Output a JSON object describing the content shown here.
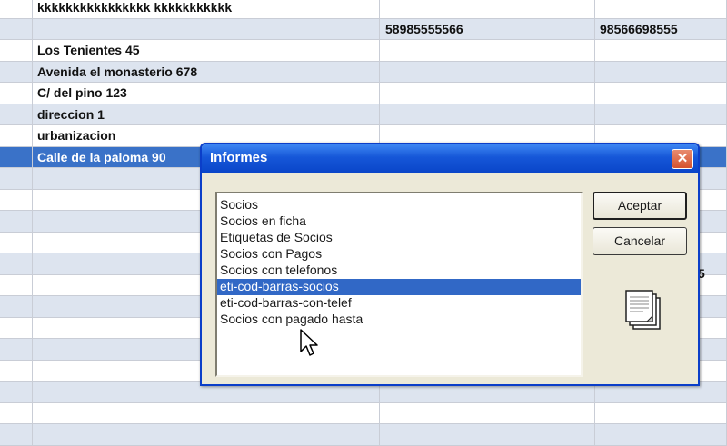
{
  "grid": {
    "rows": [
      {
        "c1": "kkkkkkkkkkkkkkkk kkkkkkkkkkk",
        "c2": "",
        "c3": "",
        "style": "normal"
      },
      {
        "c1": "",
        "c2": "58985555566",
        "c3": "98566698555",
        "style": "alt"
      },
      {
        "c1": "Los Tenientes 45",
        "c2": "",
        "c3": "",
        "style": "normal"
      },
      {
        "c1": "Avenida el monasterio 678",
        "c2": "",
        "c3": "",
        "style": "alt"
      },
      {
        "c1": "C/ del pino 123",
        "c2": "",
        "c3": "",
        "style": "normal"
      },
      {
        "c1": "direccion 1",
        "c2": "",
        "c3": "",
        "style": "alt"
      },
      {
        "c1": "urbanizacion",
        "c2": "",
        "c3": "",
        "style": "normal"
      },
      {
        "c1": "Calle de la paloma 90",
        "c2": "",
        "c3": "",
        "style": "sel"
      },
      {
        "c1": "",
        "c2": "",
        "c3": "",
        "style": "alt"
      },
      {
        "c1": "",
        "c2": "",
        "c3": "",
        "style": "normal"
      },
      {
        "c1": "",
        "c2": "",
        "c3": "",
        "style": "alt"
      },
      {
        "c1": "",
        "c2": "",
        "c3": "",
        "style": "normal"
      },
      {
        "c1": "",
        "c2": "",
        "c3": "",
        "style": "alt"
      },
      {
        "c1": "",
        "c2": "",
        "c3": "",
        "style": "normal"
      },
      {
        "c1": "",
        "c2": "",
        "c3": "",
        "style": "alt"
      },
      {
        "c1": "",
        "c2": "",
        "c3": "",
        "style": "normal"
      },
      {
        "c1": "",
        "c2": "",
        "c3": "",
        "style": "alt"
      },
      {
        "c1": "",
        "c2": "",
        "c3": "",
        "style": "normal"
      },
      {
        "c1": "",
        "c2": "",
        "c3": "",
        "style": "alt"
      },
      {
        "c1": "",
        "c2": "",
        "c3": "",
        "style": "normal"
      },
      {
        "c1": "",
        "c2": "",
        "c3": "",
        "style": "alt"
      }
    ],
    "clipped_fragment": "5"
  },
  "dialog": {
    "title": "Informes",
    "close_glyph": "✕",
    "reports": [
      "Socios",
      "Socios en ficha",
      "Etiquetas de Socios",
      "Socios con Pagos",
      "Socios con telefonos",
      "eti-cod-barras-socios",
      "eti-cod-barras-con-telef",
      "Socios con pagado hasta"
    ],
    "selected_index": 5,
    "accept_label": "Aceptar",
    "cancel_label": "Cancelar",
    "icon": "document-stack-icon"
  },
  "colors": {
    "selection": "#3168c6",
    "row_selected": "#3a72c8",
    "row_alt": "#dde4ef",
    "title_bar": "#1657d8",
    "close_button": "#d6532f"
  }
}
